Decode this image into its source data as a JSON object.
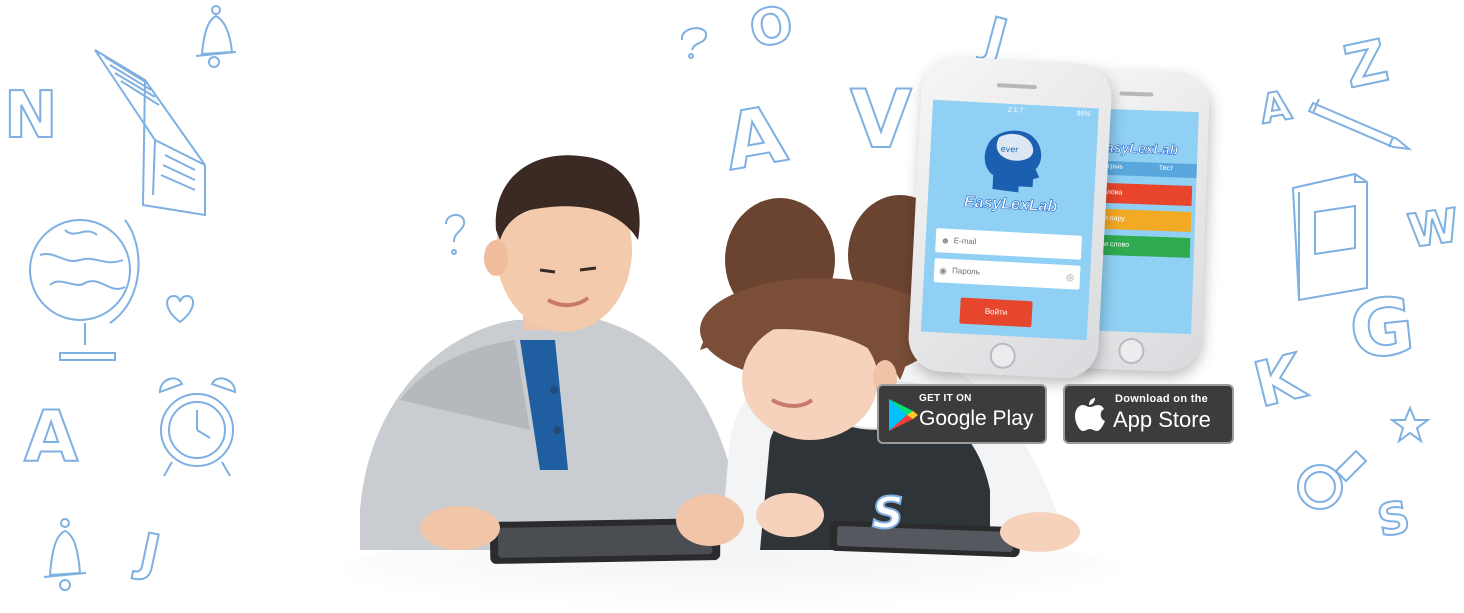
{
  "background": {
    "color": "#ffffff",
    "doodle_color": "#7fb0e2"
  },
  "doodles": {
    "letters": [
      "N",
      "A",
      "J",
      "Z",
      "A",
      "W",
      "K",
      "G",
      "S",
      "A",
      "V",
      "O",
      "J",
      "W",
      "S"
    ],
    "icons": [
      "book-icon",
      "globe-icon",
      "bell-icon",
      "heart-icon",
      "alarm-clock-icon",
      "pencil-icon",
      "notebook-icon",
      "star-icon",
      "magnifier-icon",
      "question-mark-icon"
    ]
  },
  "phone_front": {
    "status_time": "2:1:7",
    "status_battery": "96%",
    "app_name": "EasyLexLab",
    "email_placeholder": "E-mail",
    "password_placeholder": "Пароль",
    "login_button": "Войти"
  },
  "phone_back": {
    "app_name": "EasyLexLab",
    "tabs": [
      "Игрыь",
      "Тест"
    ],
    "menu": [
      {
        "label": "...чи слова",
        "color": "#e8452c"
      },
      {
        "label": "Найди пару",
        "color": "#f2a923"
      },
      {
        "label": "Впиши слово",
        "color": "#2eaa4f"
      }
    ]
  },
  "badges": {
    "google": {
      "small": "GET IT ON",
      "big": "Google Play"
    },
    "apple": {
      "small": "Download on the",
      "big": "App Store"
    }
  }
}
